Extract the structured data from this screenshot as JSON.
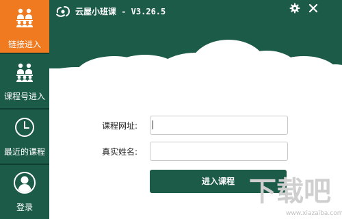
{
  "app": {
    "title": "云屋小班课 - V3.26.5"
  },
  "sidebar": {
    "items": [
      {
        "label": "链接进入",
        "icon": "group-icon",
        "active": true
      },
      {
        "label": "课程号进入",
        "icon": "group-icon",
        "active": false
      },
      {
        "label": "最近的课程",
        "icon": "clock-icon",
        "active": false
      },
      {
        "label": "登录",
        "icon": "user-icon",
        "active": false
      }
    ]
  },
  "window_controls": {
    "settings_icon": "gear-icon",
    "close_icon": "close-icon"
  },
  "form": {
    "url_label": "课程网址:",
    "url_value": "",
    "name_label": "真实姓名:",
    "name_value": "",
    "submit_label": "进入课程"
  },
  "watermark": {
    "text": "下载吧",
    "url": "www.xiazaiba.com"
  },
  "colors": {
    "brand_green": "#1d5b49",
    "active_orange": "#ef7a1f"
  }
}
